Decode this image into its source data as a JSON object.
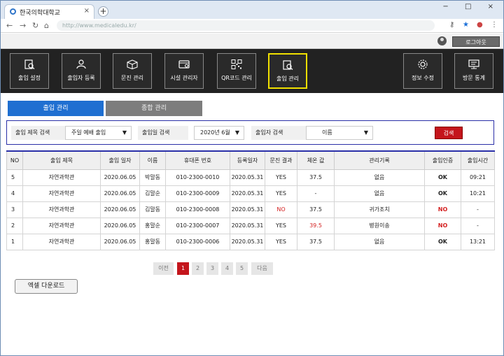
{
  "browser": {
    "tab_title": "한국의학대학교",
    "url": "http://www.medicaledu.kr/",
    "close_tab": "×",
    "new_tab": "+",
    "window_controls": "− □ ×"
  },
  "userbar": {
    "logout_label": "로그아웃"
  },
  "menu": {
    "items": [
      {
        "label": "출입 설정",
        "icon": "document-search-icon"
      },
      {
        "label": "출입자 등록",
        "icon": "user-icon"
      },
      {
        "label": "문진 관리",
        "icon": "box-icon"
      },
      {
        "label": "시설 관리자",
        "icon": "card-icon"
      },
      {
        "label": "QR코드 관리",
        "icon": "qr-code-icon"
      },
      {
        "label": "출입 관리",
        "icon": "document-search-icon",
        "active": true
      },
      {
        "label": "정보 수정",
        "icon": "gear-icon"
      },
      {
        "label": "방문 통계",
        "icon": "monitor-icon"
      }
    ]
  },
  "tabs": {
    "tab1": "출입 관리",
    "tab2": "종합 관리"
  },
  "search": {
    "title_label": "출입 제목 검색",
    "title_value": "주일 예배 출입",
    "date_label": "출입일 검색",
    "date_value": "2020년 6월",
    "person_label": "출입자 검색",
    "person_value": "이름",
    "button": "검색",
    "dropdown_arrow": "▼"
  },
  "table": {
    "headers": [
      "NO",
      "출입 제목",
      "출입 일자",
      "이름",
      "휴대폰 번호",
      "등록일자",
      "문진 결과",
      "체온 값",
      "관리기록",
      "출입인증",
      "출입시간"
    ],
    "rows": [
      [
        "5",
        "자연과학관",
        "2020.06.05",
        "박말동",
        "010-2300-0010",
        "2020.05.31",
        "YES",
        "37.5",
        "없음",
        "OK",
        "09:21"
      ],
      [
        "4",
        "자연과학관",
        "2020.06.05",
        "김말순",
        "010-2300-0009",
        "2020.05.31",
        "YES",
        "-",
        "없음",
        "OK",
        "10:21"
      ],
      [
        "3",
        "자연과학관",
        "2020.06.05",
        "김말동",
        "010-2300-0008",
        "2020.05.31",
        "NO",
        "37.5",
        "귀가조치",
        "NO",
        "-"
      ],
      [
        "2",
        "자연과학관",
        "2020.06.05",
        "홍말순",
        "010-2300-0007",
        "2020.05.31",
        "YES",
        "39.5",
        "병원이송",
        "NO",
        "-"
      ],
      [
        "1",
        "자연과학관",
        "2020.06.05",
        "홍말동",
        "010-2300-0006",
        "2020.05.31",
        "YES",
        "37.5",
        "없음",
        "OK",
        "13:21"
      ]
    ]
  },
  "pagination": {
    "prev": "이전",
    "pages": [
      "1",
      "2",
      "3",
      "4",
      "5"
    ],
    "current": "1",
    "next": "다음"
  },
  "excel_button": "엑셀 다운로드",
  "colors": {
    "accent": "#1f6fd1",
    "danger": "#c4151c",
    "menu_bg": "#222222",
    "active_border": "#f0e000"
  }
}
